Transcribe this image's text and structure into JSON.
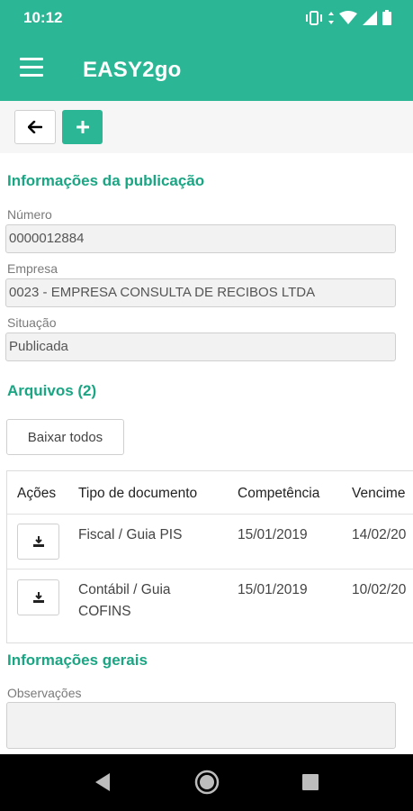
{
  "status_bar": {
    "time": "10:12"
  },
  "app_bar": {
    "title": "EASY2go"
  },
  "publication": {
    "section_title": "Informações da publicação",
    "numero_label": "Número",
    "numero_value": "0000012884",
    "empresa_label": "Empresa",
    "empresa_value": "0023 - EMPRESA CONSULTA DE RECIBOS LTDA",
    "situacao_label": "Situação",
    "situacao_value": "Publicada"
  },
  "files": {
    "section_title": "Arquivos (2)",
    "download_all_label": "Baixar todos",
    "columns": [
      "Ações",
      "Tipo de documento",
      "Competência",
      "Vencime"
    ],
    "rows": [
      {
        "tipo_line1": "Fiscal / Guia PIS",
        "tipo_line2": "",
        "competencia": "15/01/2019",
        "vencimento": "14/02/20"
      },
      {
        "tipo_line1": "Contábil / Guia",
        "tipo_line2": "COFINS",
        "competencia": "15/01/2019",
        "vencimento": "10/02/20"
      }
    ]
  },
  "general": {
    "section_title": "Informações gerais",
    "observacoes_label": "Observações",
    "observacoes_value": ""
  },
  "colors": {
    "accent": "#2bb795",
    "accent_text": "#1aa583",
    "nav_bg": "#000000"
  }
}
